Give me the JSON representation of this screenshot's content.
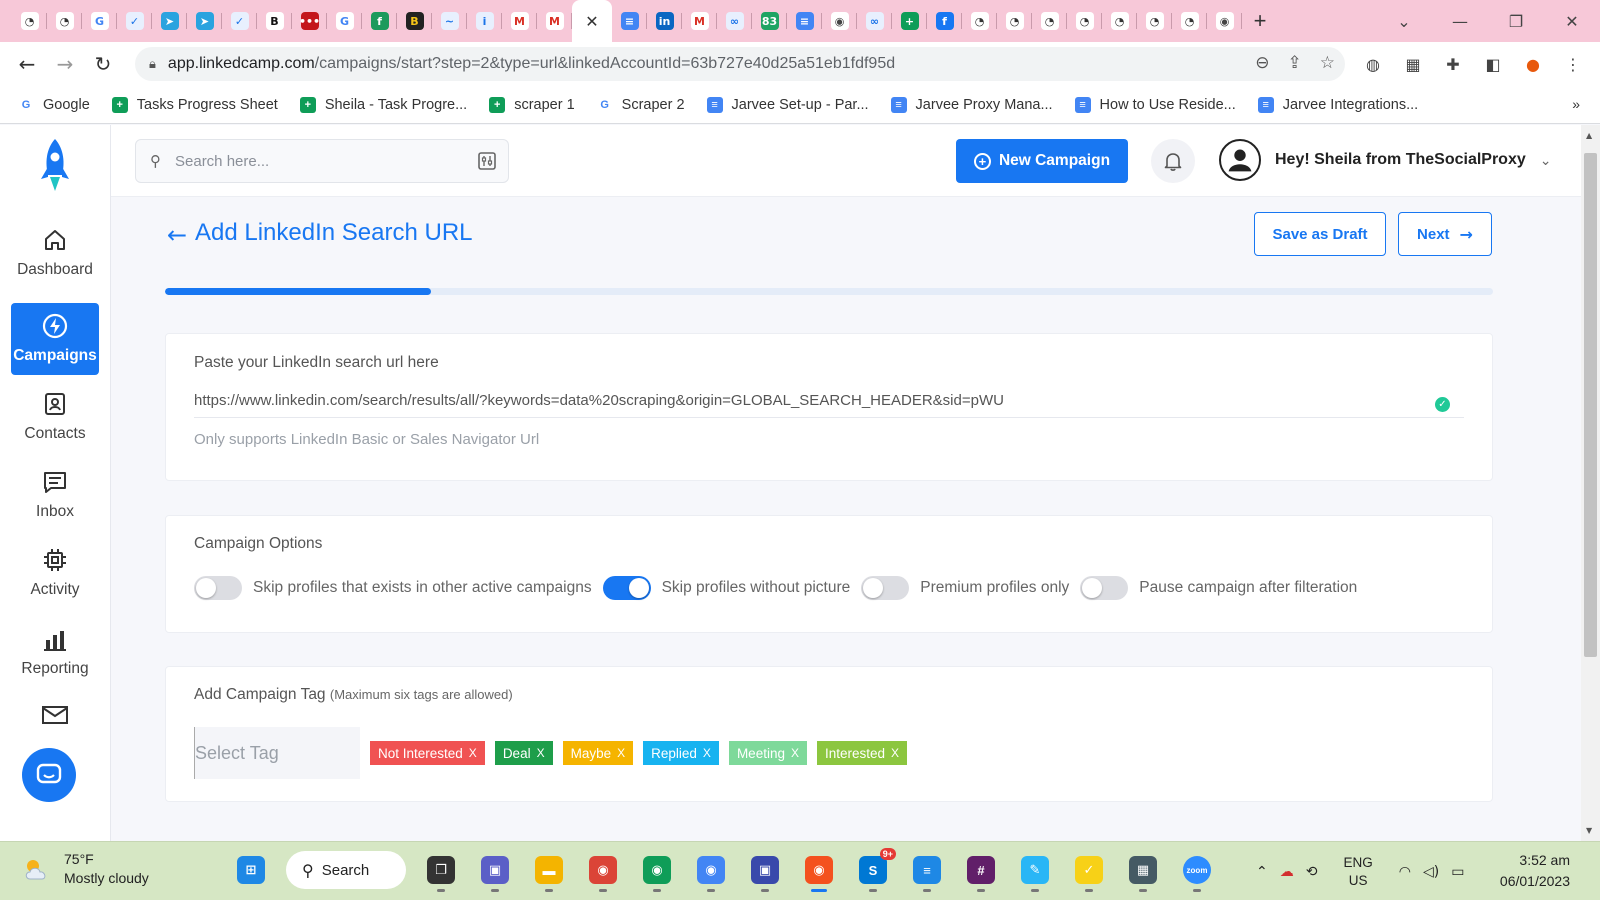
{
  "browser": {
    "tabs": [
      {
        "icon": "ghost-icon",
        "glyph": "◔",
        "color": "#ffffff",
        "text": "#333"
      },
      {
        "icon": "ghost-icon",
        "glyph": "◔",
        "color": "#ffffff",
        "text": "#333"
      },
      {
        "icon": "google-icon",
        "glyph": "G",
        "color": "#ffffff",
        "text": "#4285f4"
      },
      {
        "icon": "double-check-icon",
        "glyph": "✓",
        "color": "#e8f0fe",
        "text": "#1a73e8"
      },
      {
        "icon": "telegram-icon",
        "glyph": "➤",
        "color": "#2aa3df",
        "text": "#fff"
      },
      {
        "icon": "telegram-icon",
        "glyph": "➤",
        "color": "#2aa3df",
        "text": "#fff"
      },
      {
        "icon": "double-check-icon",
        "glyph": "✓",
        "color": "#e8f0fe",
        "text": "#1a73e8"
      },
      {
        "icon": "b-icon",
        "glyph": "B",
        "color": "#ffffff",
        "text": "#111"
      },
      {
        "icon": "dots-icon",
        "glyph": "•••",
        "color": "#c4161c",
        "text": "#fff"
      },
      {
        "icon": "google-icon",
        "glyph": "G",
        "color": "#ffffff",
        "text": "#4285f4"
      },
      {
        "icon": "fn-icon",
        "glyph": "f",
        "color": "#1c9a5c",
        "text": "#fff"
      },
      {
        "icon": "bp-icon",
        "glyph": "B",
        "color": "#222222",
        "text": "#f5c518"
      },
      {
        "icon": "swirl-icon",
        "glyph": "~",
        "color": "#e8f0fe",
        "text": "#1a73e8"
      },
      {
        "icon": "person-icon",
        "glyph": "i",
        "color": "#e8f0fe",
        "text": "#1a73e8"
      },
      {
        "icon": "gmail-icon",
        "glyph": "M",
        "color": "#ffffff",
        "text": "#d93025"
      },
      {
        "icon": "gmail-icon",
        "glyph": "M",
        "color": "#ffffff",
        "text": "#d93025"
      },
      {
        "icon": "close-icon",
        "glyph": "✕",
        "color": "#ffffff",
        "text": "#333",
        "active": true
      },
      {
        "icon": "docs-icon",
        "glyph": "≡",
        "color": "#4285f4",
        "text": "#fff"
      },
      {
        "icon": "linkedin-icon",
        "glyph": "in",
        "color": "#0a66c2",
        "text": "#fff"
      },
      {
        "icon": "gmail-icon",
        "glyph": "M",
        "color": "#ffffff",
        "text": "#d93025"
      },
      {
        "icon": "link-icon",
        "glyph": "∞",
        "color": "#e8f0fe",
        "text": "#1a73e8"
      },
      {
        "icon": "count-icon",
        "glyph": "83",
        "color": "#1fa463",
        "text": "#fff"
      },
      {
        "icon": "docs-icon",
        "glyph": "≡",
        "color": "#4285f4",
        "text": "#fff"
      },
      {
        "icon": "chrome-icon",
        "glyph": "◉",
        "color": "#ffffff",
        "text": "#444"
      },
      {
        "icon": "link-icon",
        "glyph": "∞",
        "color": "#e8f0fe",
        "text": "#1a73e8"
      },
      {
        "icon": "sheets-icon",
        "glyph": "+",
        "color": "#0f9d58",
        "text": "#fff"
      },
      {
        "icon": "facebook-icon",
        "glyph": "f",
        "color": "#1877f2",
        "text": "#fff"
      },
      {
        "icon": "ghost-icon",
        "glyph": "◔",
        "color": "#ffffff",
        "text": "#333"
      },
      {
        "icon": "ghost-icon",
        "glyph": "◔",
        "color": "#ffffff",
        "text": "#333"
      },
      {
        "icon": "ghost-icon",
        "glyph": "◔",
        "color": "#ffffff",
        "text": "#333"
      },
      {
        "icon": "ghost-icon",
        "glyph": "◔",
        "color": "#ffffff",
        "text": "#333"
      },
      {
        "icon": "ghost-icon",
        "glyph": "◔",
        "color": "#ffffff",
        "text": "#333"
      },
      {
        "icon": "ghost-icon",
        "glyph": "◔",
        "color": "#ffffff",
        "text": "#333"
      },
      {
        "icon": "ghost-icon",
        "glyph": "◔",
        "color": "#ffffff",
        "text": "#333"
      },
      {
        "icon": "chrome-icon",
        "glyph": "◉",
        "color": "#ffffff",
        "text": "#444"
      }
    ],
    "url_host": "app.linkedcamp.com",
    "url_path": "/campaigns/start?step=2&type=url&linkedAccountId=63b727e40d25a51eb1fdf95d",
    "bookmarks": [
      {
        "label": "Google",
        "icon": "google-icon",
        "color": "#ffffff",
        "glyph": "G",
        "text": "#4285f4"
      },
      {
        "label": "Tasks Progress Sheet",
        "icon": "sheets-icon",
        "color": "#0f9d58",
        "glyph": "+",
        "text": "#fff"
      },
      {
        "label": "Sheila - Task Progre...",
        "icon": "sheets-icon",
        "color": "#0f9d58",
        "glyph": "+",
        "text": "#fff"
      },
      {
        "label": "scraper 1",
        "icon": "sheets-icon",
        "color": "#0f9d58",
        "glyph": "+",
        "text": "#fff"
      },
      {
        "label": "Scraper 2",
        "icon": "google-icon",
        "color": "#ffffff",
        "glyph": "G",
        "text": "#4285f4"
      },
      {
        "label": "Jarvee Set-up - Par...",
        "icon": "docs-icon",
        "color": "#4285f4",
        "glyph": "≡",
        "text": "#fff"
      },
      {
        "label": "Jarvee Proxy Mana...",
        "icon": "docs-icon",
        "color": "#4285f4",
        "glyph": "≡",
        "text": "#fff"
      },
      {
        "label": "How to Use Reside...",
        "icon": "docs-icon",
        "color": "#4285f4",
        "glyph": "≡",
        "text": "#fff"
      },
      {
        "label": "Jarvee Integrations...",
        "icon": "docs-icon",
        "color": "#4285f4",
        "glyph": "≡",
        "text": "#fff"
      }
    ],
    "bookmarks_more": "»"
  },
  "sidebar": {
    "items": [
      {
        "label": "Dashboard",
        "icon": "home-icon"
      },
      {
        "label": "Campaigns",
        "icon": "lightning-icon",
        "active": true
      },
      {
        "label": "Contacts",
        "icon": "contact-card-icon"
      },
      {
        "label": "Inbox",
        "icon": "message-icon"
      },
      {
        "label": "Activity",
        "icon": "chip-icon"
      },
      {
        "label": "Reporting",
        "icon": "bar-chart-icon"
      }
    ]
  },
  "topbar": {
    "search_placeholder": "Search here...",
    "new_campaign_label": "New Campaign",
    "profile_name": "Hey! Sheila from TheSocialProxy"
  },
  "page": {
    "title": "Add LinkedIn Search URL",
    "save_draft_label": "Save as Draft",
    "next_label": "Next",
    "progress": 0.2
  },
  "url_card": {
    "label": "Paste your LinkedIn search url here",
    "value": "https://www.linkedin.com/search/results/all/?keywords=data%20scraping&origin=GLOBAL_SEARCH_HEADER&sid=pWU",
    "hint": "Only supports LinkedIn Basic or Sales Navigator Url"
  },
  "options_card": {
    "label": "Campaign Options",
    "options": [
      {
        "label": "Skip profiles that exists in other active campaigns",
        "on": false
      },
      {
        "label": "Skip profiles without picture",
        "on": true
      },
      {
        "label": "Premium profiles only",
        "on": false
      },
      {
        "label": "Pause campaign after filteration",
        "on": false
      }
    ]
  },
  "tag_card": {
    "label": "Add Campaign Tag",
    "note": "(Maximum six tags are allowed)",
    "select_placeholder": "Select Tag",
    "tags": [
      {
        "label": "Not Interested",
        "color": "#f05252"
      },
      {
        "label": "Deal",
        "color": "#1e9e4a"
      },
      {
        "label": "Maybe",
        "color": "#f5b400"
      },
      {
        "label": "Replied",
        "color": "#17b3f0"
      },
      {
        "label": "Meeting",
        "color": "#7ed99a"
      },
      {
        "label": "Interested",
        "color": "#8cc63f"
      }
    ]
  },
  "taskbar": {
    "temperature": "75°F",
    "weather": "Mostly cloudy",
    "search_label": "Search",
    "apps": [
      {
        "icon": "windows-start-icon",
        "color": "#1e88e5",
        "glyph": "⊞"
      },
      {
        "icon": "search-box",
        "color": "",
        "glyph": ""
      },
      {
        "icon": "task-view-icon",
        "color": "#333333",
        "glyph": "❐"
      },
      {
        "icon": "meet-icon",
        "color": "#5b5fc7",
        "glyph": "▣"
      },
      {
        "icon": "file-explorer-icon",
        "color": "#f4b400",
        "glyph": "▬"
      },
      {
        "icon": "chrome-icon",
        "color": "#db4437",
        "glyph": "◉"
      },
      {
        "icon": "chrome-icon",
        "color": "#0f9d58",
        "glyph": "◉"
      },
      {
        "icon": "chrome-icon",
        "color": "#4285f4",
        "glyph": "◉"
      },
      {
        "icon": "remote-desktop-icon",
        "color": "#3949ab",
        "glyph": "▣"
      },
      {
        "icon": "chrome-icon",
        "color": "#f4511e",
        "glyph": "◉",
        "current": true
      },
      {
        "icon": "skype-icon",
        "color": "#0078d4",
        "glyph": "S",
        "badge": "9+"
      },
      {
        "icon": "notepad-icon",
        "color": "#1e88e5",
        "glyph": "≡"
      },
      {
        "icon": "slack-icon",
        "color": "#611f69",
        "glyph": "#"
      },
      {
        "icon": "paint-icon",
        "color": "#29b6f6",
        "glyph": "✎"
      },
      {
        "icon": "norton-icon",
        "color": "#f7d117",
        "glyph": "✓"
      },
      {
        "icon": "calculator-icon",
        "color": "#455a64",
        "glyph": "▦"
      },
      {
        "icon": "zoom-icon",
        "color": "#2d8cff",
        "glyph": "zoom"
      }
    ],
    "lang_1": "ENG",
    "lang_2": "US",
    "time": "3:52 am",
    "date": "06/01/2023"
  }
}
